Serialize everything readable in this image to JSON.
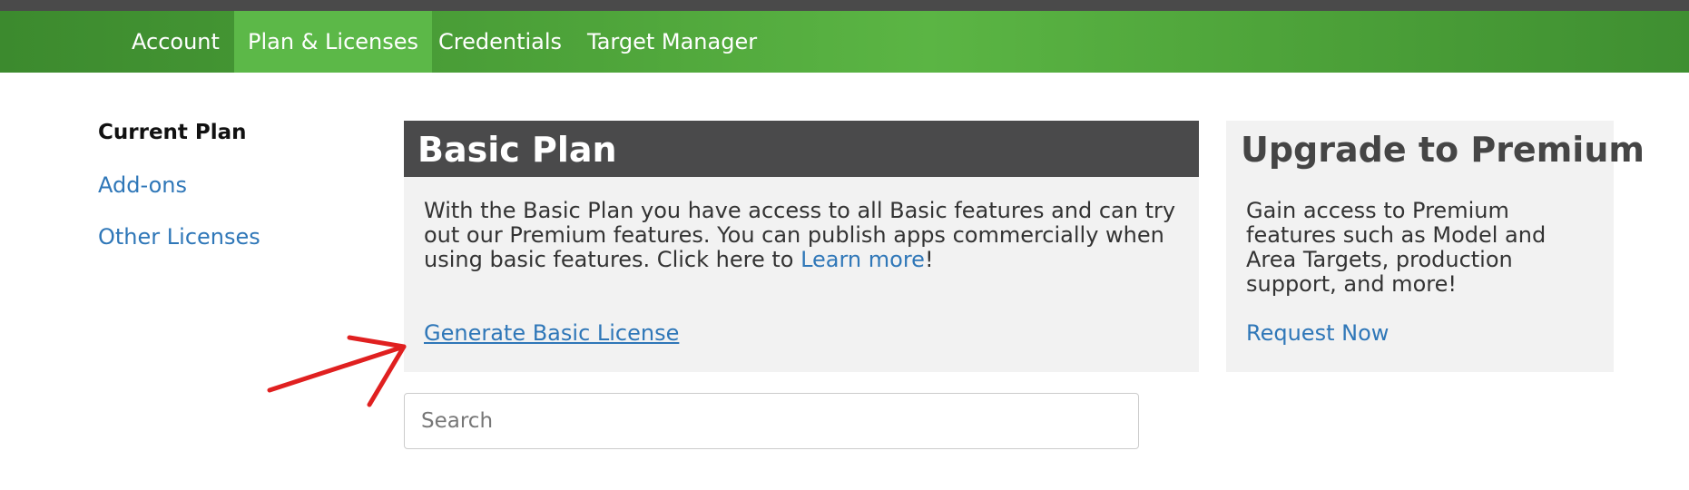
{
  "nav": {
    "items": [
      {
        "label": "Account"
      },
      {
        "label": "Plan & Licenses",
        "active": true
      },
      {
        "label": "Credentials"
      },
      {
        "label": "Target Manager"
      }
    ]
  },
  "sidebar": {
    "items": [
      {
        "label": "Current Plan",
        "current": true
      },
      {
        "label": "Add-ons"
      },
      {
        "label": "Other Licenses"
      }
    ]
  },
  "basic_plan": {
    "title": "Basic Plan",
    "description": "With the Basic Plan you have access to all Basic features and can try out our Premium features. You can publish apps commercially when using basic features. Click here to ",
    "learn_more": "Learn more",
    "punct": "!",
    "action": "Generate Basic License"
  },
  "premium": {
    "title": "Upgrade to Premium",
    "description": "Gain access to Premium features such as Model and Area Targets, production support, and more!",
    "action": "Request Now"
  },
  "search": {
    "placeholder": "Search"
  },
  "colors": {
    "nav_green": "#4ea43a",
    "nav_active": "#5cb848",
    "link": "#2f77b8",
    "card_bg": "#f2f2f2",
    "header_dark": "#4a4a4b",
    "annotation_arrow": "#e02020"
  }
}
